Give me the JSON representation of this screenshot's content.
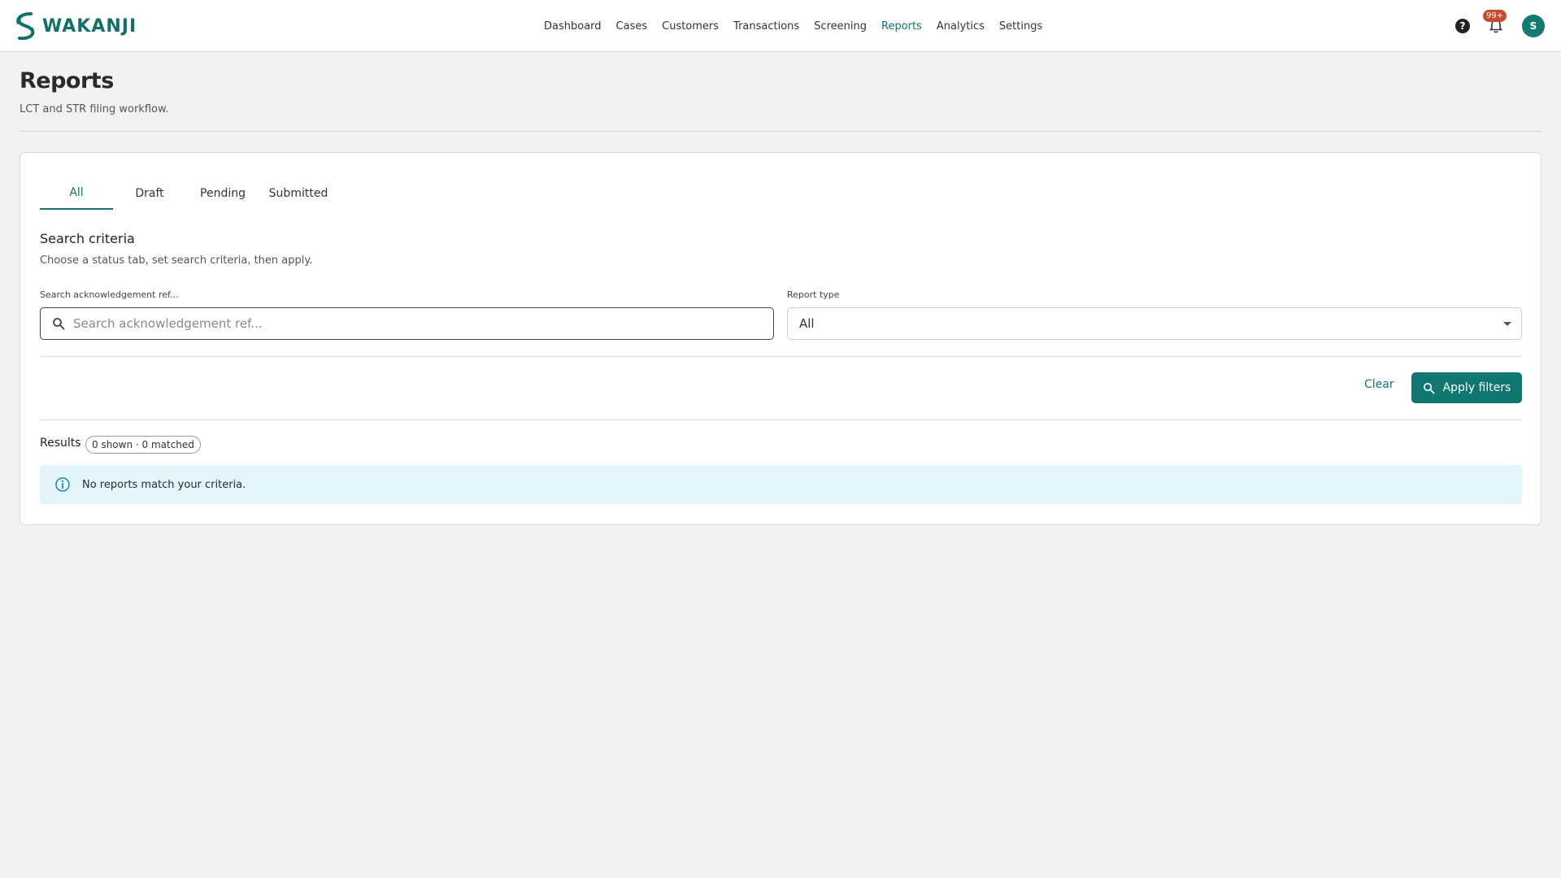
{
  "brand": {
    "name": "WAKANJI"
  },
  "nav": {
    "items": [
      {
        "label": "Dashboard"
      },
      {
        "label": "Cases"
      },
      {
        "label": "Customers"
      },
      {
        "label": "Transactions"
      },
      {
        "label": "Screening"
      },
      {
        "label": "Reports"
      },
      {
        "label": "Analytics"
      },
      {
        "label": "Settings"
      }
    ],
    "active": "Reports"
  },
  "header": {
    "help_icon": "?",
    "notifications_badge": "99+",
    "avatar_initial": "S"
  },
  "page": {
    "title": "Reports",
    "subtitle": "LCT and STR filing workflow."
  },
  "tabs": {
    "items": [
      {
        "label": "All"
      },
      {
        "label": "Draft"
      },
      {
        "label": "Pending"
      },
      {
        "label": "Submitted"
      }
    ],
    "active": "All"
  },
  "criteria": {
    "title": "Search criteria",
    "description": "Choose a status tab, set search criteria, then apply.",
    "search_label": "Search acknowledgement ref...",
    "search_placeholder": "Search acknowledgement ref...",
    "search_value": "",
    "report_type_label": "Report type",
    "report_type_value": "All"
  },
  "actions": {
    "clear_label": "Clear",
    "apply_label": "Apply filters"
  },
  "results": {
    "label": "Results",
    "summary": "0 shown · 0 matched",
    "empty_message": "No reports match your criteria."
  },
  "colors": {
    "accent": "#0f7670",
    "badge": "#c84a2f",
    "alert_bg": "#e4f4fb",
    "page_bg": "#f2f2f2"
  },
  "icons": [
    "logo-mark-icon",
    "help-icon",
    "bell-icon",
    "search-icon",
    "chevron-down-icon",
    "info-icon"
  ]
}
